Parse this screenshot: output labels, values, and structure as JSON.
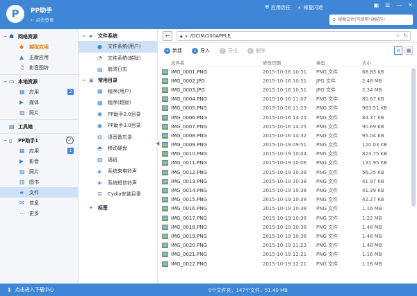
{
  "titlebar": {
    "logo_text": "P",
    "app_title": "PP助手",
    "login_link": "← 点击登录",
    "trust_label": "应用信任",
    "flash_fix_label": "修复闪退",
    "search_placeholder": "搜索文件(可使用*通配符)"
  },
  "leftnav": {
    "network": {
      "title": "网络资源",
      "items": [
        {
          "label": "越狱应用",
          "icon": "jailbreak-icon"
        },
        {
          "label": "正版应用",
          "icon": "appstore-icon"
        },
        {
          "label": "影音图铃",
          "icon": "music-icon"
        }
      ]
    },
    "local": {
      "title": "本地资源",
      "items": [
        {
          "label": "应用",
          "badge": "2"
        },
        {
          "label": "媒体"
        },
        {
          "label": "照片"
        }
      ]
    },
    "toolbox": {
      "title": "工具箱"
    },
    "device": {
      "title": "PP助手1",
      "items": [
        {
          "label": "应用",
          "badge": "1"
        },
        {
          "label": "影音"
        },
        {
          "label": "照片"
        },
        {
          "label": "图书"
        },
        {
          "label": "文件"
        },
        {
          "label": "信息"
        },
        {
          "label": "更多"
        }
      ]
    }
  },
  "midnav": {
    "filesystem": {
      "title": "文件系统",
      "items": [
        "文件系统(用户)",
        "文件系统(越狱)",
        "崩溃日志"
      ]
    },
    "common": {
      "title": "常用目录",
      "items": [
        "程序(用户)",
        "程序(越狱)",
        "PP助手2.0目录",
        "PP助手3.0目录",
        "语音备忘录",
        "移动硬盘",
        "墙纸",
        "系统来电铃声",
        "系统短信铃声",
        "Cydia安装目录"
      ]
    },
    "tags": {
      "title": "标签"
    }
  },
  "pathbar": {
    "path": "/DCIM/100APPLE"
  },
  "toolbar": {
    "new_label": "新建",
    "import_label": "导入",
    "export_label": "导出",
    "delete_label": "删除"
  },
  "table": {
    "headers": {
      "name": "文件名",
      "date": "修改日期",
      "type": "类型",
      "size": "大小"
    },
    "rows": [
      {
        "name": "IMG_0001.PNG",
        "date": "2015-10-16 10:51",
        "type": "PNG 文件",
        "size": "68.83 KB"
      },
      {
        "name": "IMG_0002.JPG",
        "date": "2015-10-16 10:51",
        "type": "JPG 文件",
        "size": "2.48 MB"
      },
      {
        "name": "IMG_0003.JPG",
        "date": "2015-10-16 10:51",
        "type": "JPG 文件",
        "size": "2.34 MB"
      },
      {
        "name": "IMG_0004.PNG",
        "date": "2015-10-16 11:07",
        "type": "PNG 文件",
        "size": "80.67 KB"
      },
      {
        "name": "IMG_0005.PNG",
        "date": "2015-10-16 11:23",
        "type": "PNG 文件",
        "size": "963.51 KB"
      },
      {
        "name": "IMG_0006.PNG",
        "date": "2015-10-16 14:25",
        "type": "PNG 文件",
        "size": "84.37 KB"
      },
      {
        "name": "IMG_0007.PNG",
        "date": "2015-10-16 14:25",
        "type": "PNG 文件",
        "size": "90.69 KB"
      },
      {
        "name": "IMG_0008.PNG",
        "date": "2015-10-16 14:32",
        "type": "PNG 文件",
        "size": "95.04 KB"
      },
      {
        "name": "IMG_0009.PNG",
        "date": "2015-10-19 09:51",
        "type": "PNG 文件",
        "size": "120.03 KB"
      },
      {
        "name": "IMG_0010.PNG",
        "date": "2015-10-19 10:04",
        "type": "PNG 文件",
        "size": "823.75 KB"
      },
      {
        "name": "IMG_0011.PNG",
        "date": "2015-10-19 10:06",
        "type": "PNG 文件",
        "size": "131.95 KB"
      },
      {
        "name": "IMG_0012.PNG",
        "date": "2015-10-19 10:38",
        "type": "PNG 文件",
        "size": "56.25 KB"
      },
      {
        "name": "IMG_0013.PNG",
        "date": "2015-10-19 10:38",
        "type": "PNG 文件",
        "size": "41.97 KB"
      },
      {
        "name": "IMG_0014.PNG",
        "date": "2015-10-19 10:38",
        "type": "PNG 文件",
        "size": "41.39 KB"
      },
      {
        "name": "IMG_0015.PNG",
        "date": "2015-10-19 10:38",
        "type": "PNG 文件",
        "size": "42.27 KB"
      },
      {
        "name": "IMG_0016.PNG",
        "date": "2015-10-19 10:38",
        "type": "PNG 文件",
        "size": "1.16 MB"
      },
      {
        "name": "IMG_0017.PNG",
        "date": "2015-10-19 10:38",
        "type": "PNG 文件",
        "size": "1.22 MB"
      },
      {
        "name": "IMG_0018.PNG",
        "date": "2015-10-19 10:38",
        "type": "PNG 文件",
        "size": "1.48 MB"
      },
      {
        "name": "IMG_0019.PNG",
        "date": "2015-10-19 10:38",
        "type": "PNG 文件",
        "size": "1.48 MB"
      },
      {
        "name": "IMG_0020.PNG",
        "date": "2015-10-19 11:23",
        "type": "PNG 文件",
        "size": "1.48 MB"
      },
      {
        "name": "IMG_0021.PNG",
        "date": "2015-10-19 12:21",
        "type": "PNG 文件",
        "size": "1.16 MB"
      },
      {
        "name": "IMG_0022.PNG",
        "date": "2015-10-19 12:21",
        "type": "PNG 文件",
        "size": "1.16 MB"
      }
    ]
  },
  "statusbar": {
    "download_center": "点击进入下载中心",
    "summary": "0个文件夹，147个文件，51.40 MB"
  },
  "colors": {
    "accent": "#3f86d6",
    "highlight": "#e57b10",
    "selected_row": "#cfe1f7"
  }
}
